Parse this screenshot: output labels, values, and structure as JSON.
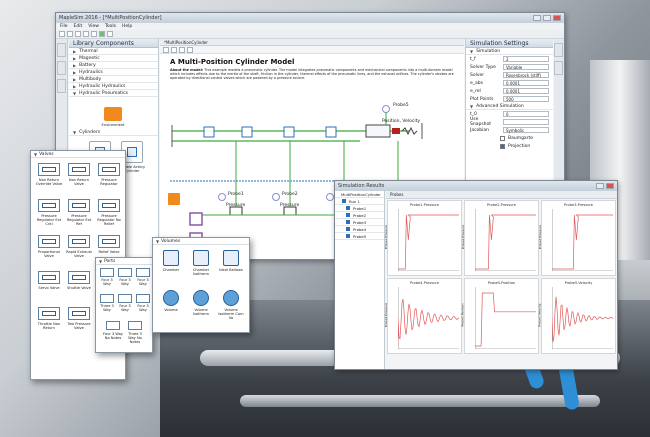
{
  "main_window": {
    "title": "MapleSim 2016 - [*MultiPositionCylinder]",
    "menus": [
      "File",
      "Edit",
      "View",
      "Tools",
      "Help"
    ],
    "tab_label": "*MultiPositionCylinder"
  },
  "library": {
    "header": "Library Components",
    "categories": [
      "Thermal",
      "Magnetic",
      "Battery",
      "Hydraulics",
      "Multibody",
      "Hydraulic Hydraulics",
      "Hydraulic Pneumatics"
    ],
    "environment_label": "Environment",
    "cylinders_label": "Cylinders",
    "cylinder_items": [
      "Bellows",
      "Double Acting Cylinder"
    ]
  },
  "model": {
    "title": "A Multi-Position Cylinder Model",
    "about_label": "About the model:",
    "about_text": "This example models a pneumatic cylinder. The model integrates pneumatic components and mechanical components into a multi-domain model which includes effects due to the inertia of the shaft, friction in the cylinder, thermal effects of the pneumatic lines, and the exhaust orifices. The cylinder's strokes are operated by directional control valves which are powered by a pressure source.",
    "probe5": {
      "name": "Probe5",
      "readout": "Position, Velocity"
    },
    "probes": [
      {
        "name": "Probe1",
        "readout": "Pressure"
      },
      {
        "name": "Probe2",
        "readout": "Pressure"
      },
      {
        "name": "Probe3",
        "readout": "Pressure"
      },
      {
        "name": "Probe4",
        "readout": "Pressure"
      }
    ]
  },
  "settings": {
    "header": "Simulation Settings",
    "simulation_label": "Simulation",
    "rows": [
      {
        "label": "t_f",
        "value": "2"
      },
      {
        "label": "Solver Type",
        "value": "Variable"
      },
      {
        "label": "Solver",
        "value": "Rosenbrock (stiff)"
      },
      {
        "label": "e_abs",
        "value": "0.0001"
      },
      {
        "label": "e_rel",
        "value": "0.0001"
      },
      {
        "label": "Plot Points",
        "value": "500"
      }
    ],
    "advanced_label": "Advanced Simulation",
    "t0_label": "t_0",
    "t0_value": "0",
    "snapshot_label": "Use Snapshot",
    "jacobian_label": "Jacobian",
    "jacobian_value": "Symbolic",
    "checks": [
      "Baumgarte",
      "Projection"
    ]
  },
  "valves_palette": {
    "title": "Valves",
    "items": [
      "Non Return Override Valve",
      "Non Return Valve",
      "Pressure Regulator",
      "Pressure Regulator Ext Cntl",
      "Pressure Regulator Ext Ref",
      "Pressure Regulator No Relief",
      "Proportional Valve",
      "Rapid Exhaust Valve",
      "Relief Valve",
      "Servo Valve",
      "Shuttle Valve",
      "Soft Start Valve",
      "Throttle Non Return",
      "Two Pressure Valve",
      "Variable Nozzle"
    ],
    "dcv_labels": [
      "DCV 3 2 Open",
      "DCV 3 2 Closed",
      "DCV 5 2",
      "DCV 5 3 Open"
    ]
  },
  "volumes_palette": {
    "title": "Volumes",
    "items": [
      "Chamber",
      "Chamber Isotherm",
      "Ideal Bellows",
      "Volume",
      "Volume Isotherm",
      "Volume Isotherm Com Vo"
    ]
  },
  "ports_palette": {
    "title": "Ports",
    "items": [
      "Four 3 Way",
      "Four 3 Way",
      "Four 3 Way",
      "Three 3 Way",
      "Four 3 Way",
      "Four 3 Way"
    ],
    "bottom_items": [
      "Four 3 Way No Notes",
      "Three 3 Way No Notes"
    ]
  },
  "results": {
    "title": "Simulation Results",
    "tab_label": "Probes",
    "tree_items": [
      "MultiPositionCylinder",
      "Run 1",
      "Probe1",
      "Probe2",
      "Probe3",
      "Probe4",
      "Probe5"
    ],
    "plots": [
      {
        "title": "Probe1.Pressure",
        "ylabel": "Probe1.Pressure"
      },
      {
        "title": "Probe2.Pressure",
        "ylabel": "Probe2.Pressure"
      },
      {
        "title": "Probe3.Pressure",
        "ylabel": "Probe3.Pressure"
      },
      {
        "title": "Probe4.Pressure",
        "ylabel": "Probe4.Pressure"
      },
      {
        "title": "Probe5.Position",
        "ylabel": "Probe5.Position"
      },
      {
        "title": "Probe5.Velocity",
        "ylabel": "Probe5.Velocity"
      }
    ]
  },
  "colors": {
    "accent": "#2d6fb8",
    "plot_line": "#e05a5a",
    "probe": "#8a8fd6",
    "hydraulic_line": "#3cab3c"
  },
  "icons": [
    "gear-icon",
    "probe-icon",
    "valve-icon",
    "chamber-icon"
  ]
}
